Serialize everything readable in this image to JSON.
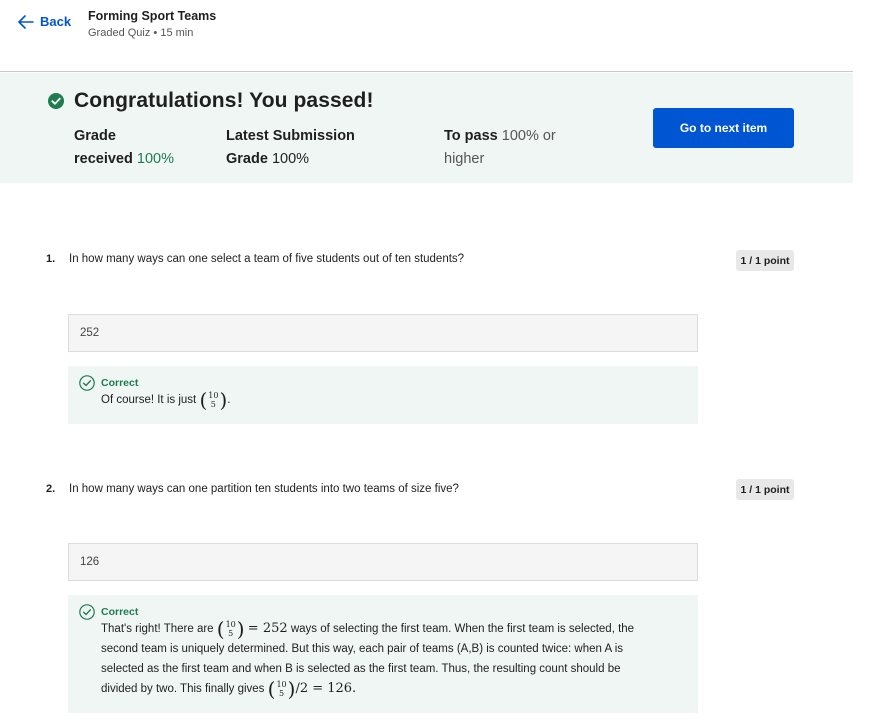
{
  "header": {
    "back_label": "Back",
    "title": "Forming Sport Teams",
    "subtitle": "Graded Quiz • 15 min"
  },
  "banner": {
    "headline": "Congratulations! You passed!",
    "grade_label_1": "Grade",
    "grade_label_2": "received",
    "grade_value": "100%",
    "latest_label_1": "Latest Submission",
    "latest_label_2": "Grade",
    "latest_value": "100%",
    "pass_label": "To pass",
    "pass_value_1": "100% or",
    "pass_value_2": "higher",
    "next_button": "Go to next item",
    "accent_color": "#1d7c50",
    "button_color": "#0056d2"
  },
  "questions": [
    {
      "number": "1.",
      "text": "In how many ways can one select a team of five students out of ten students?",
      "points": "1 / 1 point",
      "answer": "252",
      "feedback_label": "Correct",
      "feedback_pre": "Of course! It is just",
      "binom_top": "10",
      "binom_bottom": "5",
      "feedback_post": "."
    },
    {
      "number": "2.",
      "text": "In how many ways can one partition ten students into two teams of size five?",
      "points": "1 / 1 point",
      "answer": "126",
      "feedback_label": "Correct",
      "line1_pre": "That's right! There are",
      "binom_top": "10",
      "binom_bottom": "5",
      "line1_math": "= 252",
      "line1_post": "ways of selecting the first team. When the first team is selected, the",
      "line2": "second team is uniquely determined. But this way, each pair of teams (A,B) is counted twice: when A is",
      "line3": "selected as the first team and when B is selected as the first team. Thus, the resulting count should be",
      "line4_pre": "divided by two. This finally gives",
      "line4_math": "/2 = 126."
    }
  ]
}
